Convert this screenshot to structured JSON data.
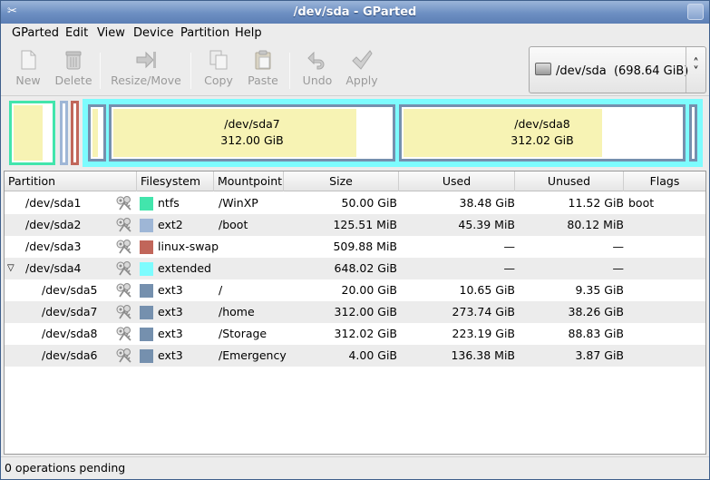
{
  "window": {
    "title": "/dev/sda - GParted"
  },
  "menu": [
    "GParted",
    "Edit",
    "View",
    "Device",
    "Partition",
    "Help"
  ],
  "toolbar": {
    "new": "New",
    "delete": "Delete",
    "resize_move": "Resize/Move",
    "copy": "Copy",
    "paste": "Paste",
    "undo": "Undo",
    "apply": "Apply"
  },
  "device_selector": {
    "device": "/dev/sda",
    "size": "(698.64 GiB)"
  },
  "visual": {
    "sda7": {
      "name": "/dev/sda7",
      "size": "312.00 GiB",
      "used_fraction": 0.877
    },
    "sda8": {
      "name": "/dev/sda8",
      "size": "312.02 GiB",
      "used_fraction": 0.715
    }
  },
  "columns": [
    "Partition",
    "Filesystem",
    "Mountpoint",
    "Size",
    "Used",
    "Unused",
    "Flags"
  ],
  "partitions": [
    {
      "partition": "/dev/sda1",
      "filesystem": "ntfs",
      "color": "#42e5ac",
      "mountpoint": "/WinXP",
      "size": "50.00 GiB",
      "used": "38.48 GiB",
      "unused": "11.52 GiB",
      "flags": "boot",
      "indent": 0,
      "expander": ""
    },
    {
      "partition": "/dev/sda2",
      "filesystem": "ext2",
      "color": "#9eb6d6",
      "mountpoint": "/boot",
      "size": "125.51 MiB",
      "used": "45.39 MiB",
      "unused": "80.12 MiB",
      "flags": "",
      "indent": 0,
      "expander": ""
    },
    {
      "partition": "/dev/sda3",
      "filesystem": "linux-swap",
      "color": "#c1665a",
      "mountpoint": "",
      "size": "509.88 MiB",
      "used": "—",
      "unused": "—",
      "flags": "",
      "indent": 0,
      "expander": ""
    },
    {
      "partition": "/dev/sda4",
      "filesystem": "extended",
      "color": "#7dfcfe",
      "mountpoint": "",
      "size": "648.02 GiB",
      "used": "—",
      "unused": "—",
      "flags": "",
      "indent": 0,
      "expander": "▽"
    },
    {
      "partition": "/dev/sda5",
      "filesystem": "ext3",
      "color": "#7590ae",
      "mountpoint": "/",
      "size": "20.00 GiB",
      "used": "10.65 GiB",
      "unused": "9.35 GiB",
      "flags": "",
      "indent": 1,
      "expander": ""
    },
    {
      "partition": "/dev/sda7",
      "filesystem": "ext3",
      "color": "#7590ae",
      "mountpoint": "/home",
      "size": "312.00 GiB",
      "used": "273.74 GiB",
      "unused": "38.26 GiB",
      "flags": "",
      "indent": 1,
      "expander": ""
    },
    {
      "partition": "/dev/sda8",
      "filesystem": "ext3",
      "color": "#7590ae",
      "mountpoint": "/Storage",
      "size": "312.02 GiB",
      "used": "223.19 GiB",
      "unused": "88.83 GiB",
      "flags": "",
      "indent": 1,
      "expander": ""
    },
    {
      "partition": "/dev/sda6",
      "filesystem": "ext3",
      "color": "#7590ae",
      "mountpoint": "/Emergency",
      "size": "4.00 GiB",
      "used": "136.38 MiB",
      "unused": "3.87 GiB",
      "flags": "",
      "indent": 1,
      "expander": ""
    }
  ],
  "status": "0 operations pending"
}
